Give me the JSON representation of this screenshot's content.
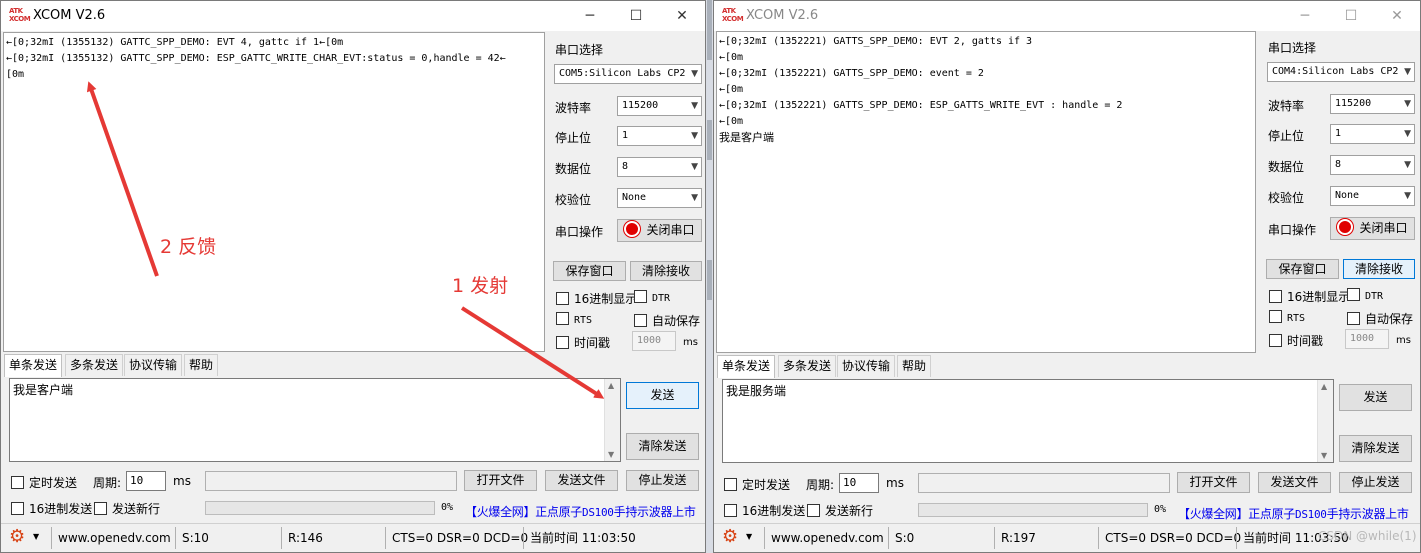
{
  "left_window": {
    "title": "XCOM V2.6",
    "terminal_lines": [
      "←[0;32mI (1355132) GATTC_SPP_DEMO: EVT 4, gattc if 1←[0m",
      "←[0;32mI (1355132) GATTC_SPP_DEMO: ESP_GATTC_WRITE_CHAR_EVT:status = 0,handle = 42←",
      "[0m"
    ],
    "settings": {
      "port_label": "串口选择",
      "port_value": "COM5:Silicon Labs CP2",
      "baud_label": "波特率",
      "baud_value": "115200",
      "stop_label": "停止位",
      "stop_value": "1",
      "data_label": "数据位",
      "data_value": "8",
      "parity_label": "校验位",
      "parity_value": "None",
      "op_label": "串口操作",
      "op_button": "关闭串口"
    },
    "buttons": {
      "save_window": "保存窗口",
      "clear_recv": "清除接收"
    },
    "checks": {
      "hex_display": "16进制显示",
      "dtr": "DTR",
      "rts": "RTS",
      "auto_save": "自动保存",
      "timestamp": "时间戳",
      "timestamp_value": "1000",
      "ms": "ms"
    },
    "tabs": [
      "单条发送",
      "多条发送",
      "协议传输",
      "帮助"
    ],
    "send_text": "我是客户端",
    "send_button": "发送",
    "clear_send_button": "清除发送",
    "bottom": {
      "timed_send": "定时发送",
      "period_label": "周期:",
      "period_value": "10",
      "ms": "ms",
      "open_file": "打开文件",
      "send_file": "发送文件",
      "stop_send": "停止发送",
      "hex_send": "16进制发送",
      "send_newline": "发送新行",
      "percent": "0%"
    },
    "ad": {
      "part1": "【火爆全网】正点原子",
      "part2": "DS100",
      "part3": "手持示波器上市"
    },
    "status": {
      "url": "www.openedv.com",
      "sent": "S:10",
      "recv": "R:146",
      "lines": "CTS=0 DSR=0 DCD=0",
      "time": "当前时间 11:03:50"
    }
  },
  "right_window": {
    "title": "XCOM V2.6",
    "terminal_lines": [
      "←[0;32mI (1352221) GATTS_SPP_DEMO: EVT 2, gatts if 3",
      "←[0m",
      "←[0;32mI (1352221) GATTS_SPP_DEMO: event = 2",
      "←[0m",
      "←[0;32mI (1352221) GATTS_SPP_DEMO: ESP_GATTS_WRITE_EVT : handle = 2",
      "←[0m",
      "我是客户端"
    ],
    "settings": {
      "port_label": "串口选择",
      "port_value": "COM4:Silicon Labs CP2",
      "baud_label": "波特率",
      "baud_value": "115200",
      "stop_label": "停止位",
      "stop_value": "1",
      "data_label": "数据位",
      "data_value": "8",
      "parity_label": "校验位",
      "parity_value": "None",
      "op_label": "串口操作",
      "op_button": "关闭串口"
    },
    "buttons": {
      "save_window": "保存窗口",
      "clear_recv": "清除接收"
    },
    "checks": {
      "hex_display": "16进制显示",
      "dtr": "DTR",
      "rts": "RTS",
      "auto_save": "自动保存",
      "timestamp": "时间戳",
      "timestamp_value": "1000",
      "ms": "ms"
    },
    "tabs": [
      "单条发送",
      "多条发送",
      "协议传输",
      "帮助"
    ],
    "send_text": "我是服务端",
    "send_button": "发送",
    "clear_send_button": "清除发送",
    "bottom": {
      "timed_send": "定时发送",
      "period_label": "周期:",
      "period_value": "10",
      "ms": "ms",
      "open_file": "打开文件",
      "send_file": "发送文件",
      "stop_send": "停止发送",
      "hex_send": "16进制发送",
      "send_newline": "发送新行",
      "percent": "0%"
    },
    "ad": {
      "part1": "【火爆全网】正点原子",
      "part2": "DS100",
      "part3": "手持示波器上市"
    },
    "status": {
      "url": "www.openedv.com",
      "sent": "S:0",
      "recv": "R:197",
      "lines": "CTS=0 DSR=0 DCD=0",
      "time": "当前时间 11:03:50"
    }
  },
  "annotations": {
    "feedback": "2 反馈",
    "transmit": "1 发射"
  },
  "watermark": "CSDN @while(1)",
  "logo_text": [
    "ATK",
    "XCOM"
  ],
  "colors": {
    "annotation": "#e53935",
    "ad_link": "#0000ee",
    "record_red": "#e00000"
  }
}
